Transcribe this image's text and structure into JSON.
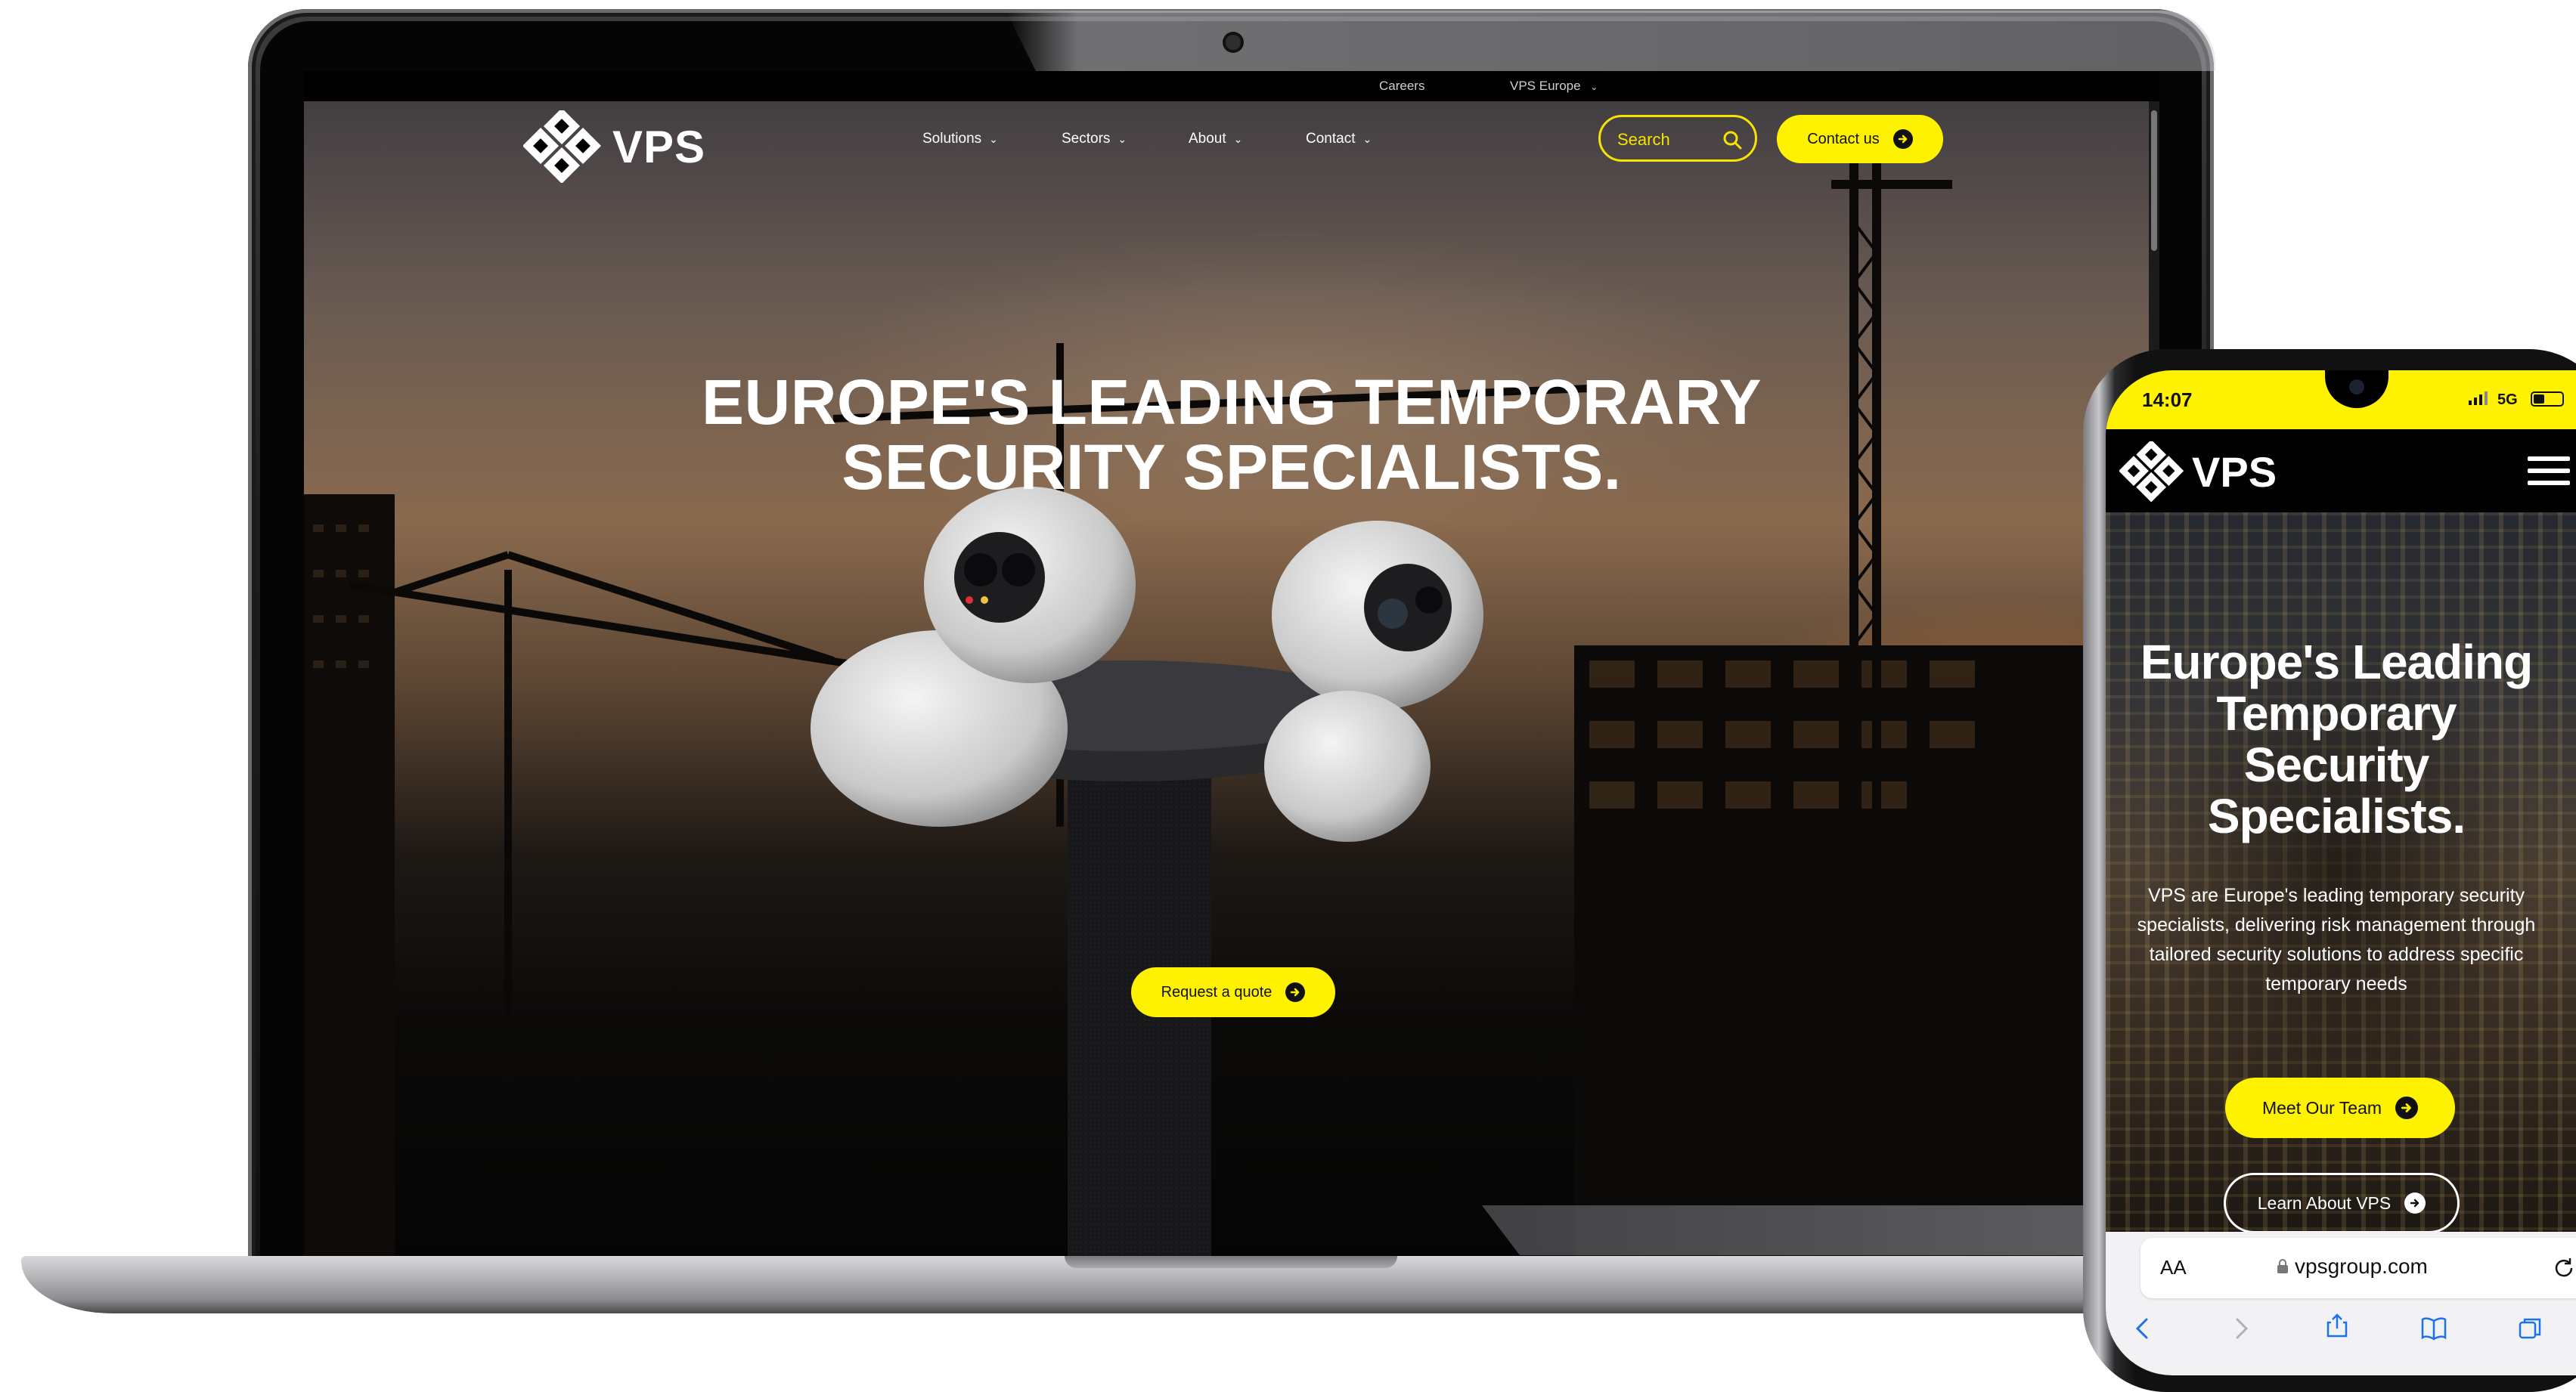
{
  "desktop_site": {
    "top_bar": {
      "careers_label": "Careers",
      "region_label": "VPS Europe"
    },
    "logo_text": "VPS",
    "nav": {
      "items": [
        {
          "label": "Solutions"
        },
        {
          "label": "Sectors"
        },
        {
          "label": "About"
        },
        {
          "label": "Contact"
        }
      ]
    },
    "search": {
      "placeholder": "Search",
      "icon": "search-icon"
    },
    "contact_button": {
      "label": "Contact us",
      "icon": "arrow-right-circle-icon"
    },
    "hero": {
      "title_line1": "EUROPE'S LEADING TEMPORARY",
      "title_line2": "SECURITY SPECIALISTS.",
      "cta_label": "Request a quote"
    }
  },
  "mobile_site": {
    "status_bar": {
      "time": "14:07",
      "network": "5G"
    },
    "logo_text": "VPS",
    "menu_icon": "hamburger-menu-icon",
    "hero": {
      "title_lines": [
        "Europe's Leading",
        "Temporary",
        "Security",
        "Specialists."
      ],
      "description_lines": [
        "VPS are Europe's leading temporary security",
        "specialists, delivering risk management through",
        "tailored security solutions to address specific",
        "temporary needs"
      ],
      "primary_button": "Meet Our Team",
      "secondary_button": "Learn About VPS"
    },
    "browser": {
      "text_size_label": "AA",
      "url": "vpsgroup.com"
    }
  },
  "colors": {
    "brand_yellow": "#fff200",
    "background": "#000000",
    "text_light": "#ffffff"
  }
}
